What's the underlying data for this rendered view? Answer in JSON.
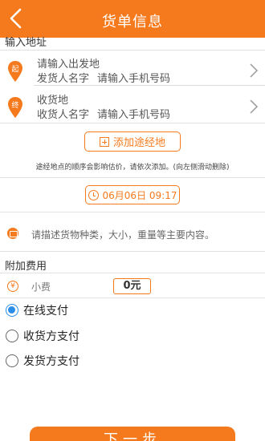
{
  "header": {
    "title": "货单信息"
  },
  "address_section": {
    "title": "输入地址"
  },
  "origin": {
    "pin_text": "起",
    "placeholder": "请输入出发地",
    "name_placeholder": "发货人名字",
    "phone_placeholder": "请输入手机号码"
  },
  "destination": {
    "pin_text": "终",
    "title": "收货地",
    "name_placeholder": "收货人名字",
    "phone_placeholder": "请输入手机号码"
  },
  "add_waypoint_label": "添加途经地",
  "waypoint_hint": "途经地点的顺序会影响估价，请依次添加。(向左侧滑动删除)",
  "datetime_label": "06月06日 09:17",
  "description_placeholder": "请描述货物种类，大小，重量等主要内容。",
  "extra_fees": {
    "title": "附加费用",
    "tip_icon": "¥",
    "tip_label": "小费",
    "tip_value": "0元"
  },
  "payment_options": [
    {
      "label": "在线支付",
      "selected": true
    },
    {
      "label": "收货方支付",
      "selected": false
    },
    {
      "label": "发货方支付",
      "selected": false
    }
  ],
  "next_button": "下一步",
  "colors": {
    "accent": "#f57a1d",
    "radio_selected": "#2a8ee8"
  }
}
